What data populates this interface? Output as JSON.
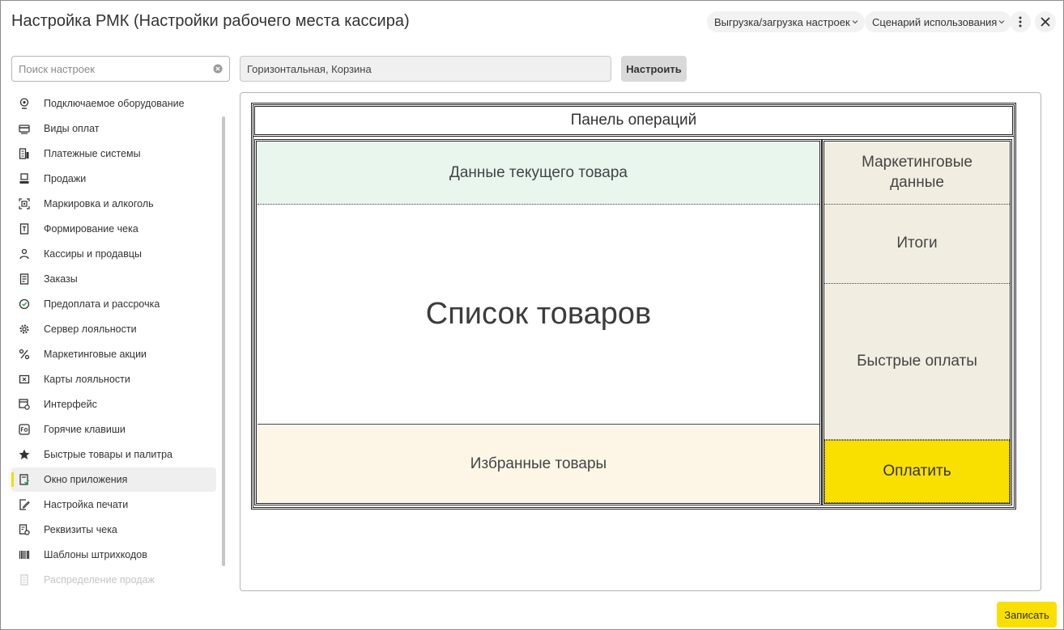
{
  "window": {
    "title": "Настройка РМК (Настройки рабочего места кассира)"
  },
  "header": {
    "export_import_label": "Выгрузка/загрузка настроек",
    "scenario_label": "Сценарий использования",
    "more_icon": "more-vertical-icon",
    "close_icon": "close-icon"
  },
  "search": {
    "placeholder": "Поиск настроек",
    "value": ""
  },
  "layout_preset": {
    "value": "Горизонтальная, Корзина",
    "configure_label": "Настроить"
  },
  "nav": {
    "items": [
      {
        "label": "Подключаемое оборудование",
        "icon": "equipment-icon"
      },
      {
        "label": "Виды оплат",
        "icon": "payment-types-icon"
      },
      {
        "label": "Платежные системы",
        "icon": "payment-systems-icon"
      },
      {
        "label": "Продажи",
        "icon": "sales-icon"
      },
      {
        "label": "Маркировка и алкоголь",
        "icon": "marking-icon"
      },
      {
        "label": "Формирование чека",
        "icon": "receipt-icon"
      },
      {
        "label": "Кассиры и продавцы",
        "icon": "cashier-icon"
      },
      {
        "label": "Заказы",
        "icon": "orders-icon"
      },
      {
        "label": "Предоплата и рассрочка",
        "icon": "prepayment-icon"
      },
      {
        "label": "Сервер лояльности",
        "icon": "gear-icon"
      },
      {
        "label": "Маркетинговые акции",
        "icon": "percent-icon"
      },
      {
        "label": "Карты лояльности",
        "icon": "loyalty-card-icon"
      },
      {
        "label": "Интерфейс",
        "icon": "interface-icon"
      },
      {
        "label": "Горячие клавиши",
        "icon": "hotkey-icon"
      },
      {
        "label": "Быстрые товары и палитра",
        "icon": "star-icon"
      },
      {
        "label": "Окно приложения",
        "icon": "app-window-icon"
      },
      {
        "label": "Настройка печати",
        "icon": "print-settings-icon"
      },
      {
        "label": "Реквизиты чека",
        "icon": "receipt-details-icon"
      },
      {
        "label": "Шаблоны штрихкодов",
        "icon": "barcode-icon"
      },
      {
        "label": "Распределение продаж",
        "icon": "distribution-icon"
      }
    ],
    "active_index": 15
  },
  "preview": {
    "operations_panel": "Панель операций",
    "current_item": "Данные текущего товара",
    "items_list": "Список товаров",
    "favorites": "Избранные товары",
    "marketing": "Маркетинговые данные",
    "totals": "Итоги",
    "quick_payments": "Быстрые оплаты",
    "pay": "Оплатить"
  },
  "footer": {
    "save_label": "Записать"
  },
  "colors": {
    "accent_yellow": "#fae000",
    "current_item_bg": "#e8f6ee",
    "favorites_bg": "#fdf6e7",
    "side_panel_bg": "#f1ede1"
  }
}
